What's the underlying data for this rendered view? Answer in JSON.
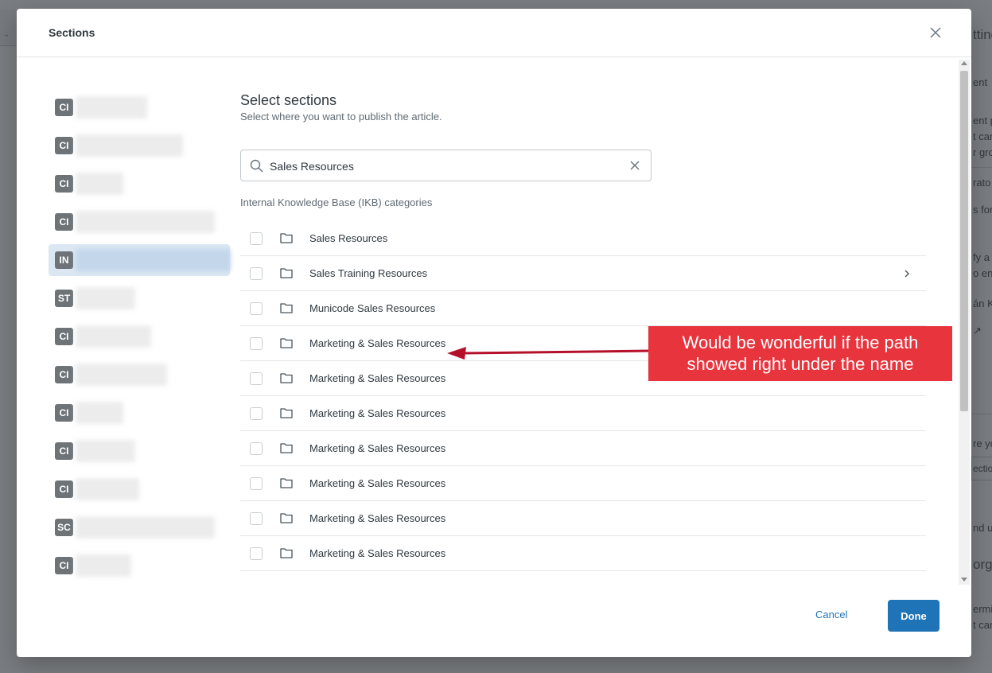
{
  "modal": {
    "title": "Sections",
    "heading": "Select sections",
    "subheading": "Select where you want to publish the article.",
    "search": {
      "value": "Sales Resources"
    },
    "category_label": "Internal Knowledge Base (IKB) categories",
    "rows": [
      {
        "label": "Sales Resources",
        "has_children": false
      },
      {
        "label": "Sales Training Resources",
        "has_children": true
      },
      {
        "label": "Municode Sales Resources",
        "has_children": false
      },
      {
        "label": "Marketing & Sales Resources",
        "has_children": false
      },
      {
        "label": "Marketing & Sales Resources",
        "has_children": false
      },
      {
        "label": "Marketing & Sales Resources",
        "has_children": false
      },
      {
        "label": "Marketing & Sales Resources",
        "has_children": false
      },
      {
        "label": "Marketing & Sales Resources",
        "has_children": false
      },
      {
        "label": "Marketing & Sales Resources",
        "has_children": false
      },
      {
        "label": "Marketing & Sales Resources",
        "has_children": false
      }
    ],
    "left_items": [
      {
        "badge": "CI",
        "selected": false
      },
      {
        "badge": "CI",
        "selected": false
      },
      {
        "badge": "CI",
        "selected": false
      },
      {
        "badge": "CI",
        "selected": false
      },
      {
        "badge": "IN",
        "selected": true
      },
      {
        "badge": "ST",
        "selected": false
      },
      {
        "badge": "CI",
        "selected": false
      },
      {
        "badge": "CI",
        "selected": false
      },
      {
        "badge": "CI",
        "selected": false
      },
      {
        "badge": "CI",
        "selected": false
      },
      {
        "badge": "CI",
        "selected": false
      },
      {
        "badge": "SC",
        "selected": false
      },
      {
        "badge": "CI",
        "selected": false
      }
    ],
    "footer": {
      "cancel_label": "Cancel",
      "done_label": "Done"
    }
  },
  "annotation": {
    "line1": "Would be wonderful if the path",
    "line2": "showed right under the name"
  },
  "background_fragments": {
    "f1": "tting",
    "f2": "ent",
    "f3": "ent p",
    "f4": "t can",
    "f5": "r gro",
    "f6": "rato",
    "f7": "s for",
    "f8": "fy a",
    "f9": "o en",
    "f10": "án K",
    "f11": "re yo",
    "f12": "ectio",
    "f13": "nd u",
    "f14": "orga",
    "f15": "ermi",
    "f16": "t can"
  },
  "colors": {
    "accent": "#1f73b7",
    "annotation_red": "#e8343d",
    "selected_bg": "#dbe7f3",
    "badge_bg": "#6e7378"
  }
}
